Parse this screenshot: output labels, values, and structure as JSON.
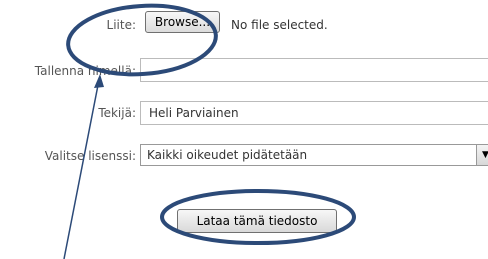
{
  "form": {
    "attachment_label": "Liite:",
    "browse_button": "Browse...",
    "file_status": "No file selected.",
    "save_name_label": "Tallenna nimellä:",
    "save_name_value": "",
    "author_label": "Tekijä:",
    "author_value": "Heli Parviainen",
    "license_label": "Valitse lisenssi:",
    "license_value": "Kaikki oikeudet pidätetään",
    "upload_button": "Lataa tämä tiedosto"
  },
  "annotation": {
    "color": "#2c4a78"
  }
}
